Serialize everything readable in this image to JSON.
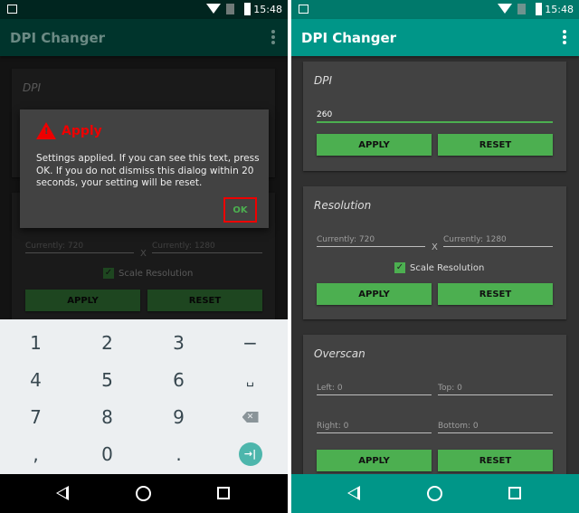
{
  "status": {
    "time": "15:48"
  },
  "app": {
    "title": "DPI Changer"
  },
  "dpi": {
    "title": "DPI",
    "value": "260",
    "apply": "APPLY",
    "reset": "RESET"
  },
  "resolution": {
    "title": "Resolution",
    "width_placeholder": "Currently: 720",
    "height_placeholder": "Currently: 1280",
    "separator": "X",
    "scale_label": "Scale Resolution",
    "scale_checked": true,
    "apply": "APPLY",
    "reset": "RESET"
  },
  "overscan": {
    "title": "Overscan",
    "left": "Left: 0",
    "top": "Top: 0",
    "right": "Right: 0",
    "bottom": "Bottom: 0",
    "apply": "APPLY",
    "reset": "RESET"
  },
  "dialog": {
    "title": "Apply",
    "message": "Settings applied. If you can see this text, press OK. If you do not dismiss this dialog within 20 seconds, your setting will be reset.",
    "ok": "OK",
    "icon": "warning-icon"
  },
  "keyboard": {
    "keys": [
      "1",
      "2",
      "3",
      "−",
      "4",
      "5",
      "6",
      "␣",
      "7",
      "8",
      "9",
      "⌫",
      ",",
      "0",
      ".",
      "⇥"
    ]
  },
  "colors": {
    "primary": "#009688",
    "accent": "#4caf50",
    "warning": "#ee0000"
  }
}
